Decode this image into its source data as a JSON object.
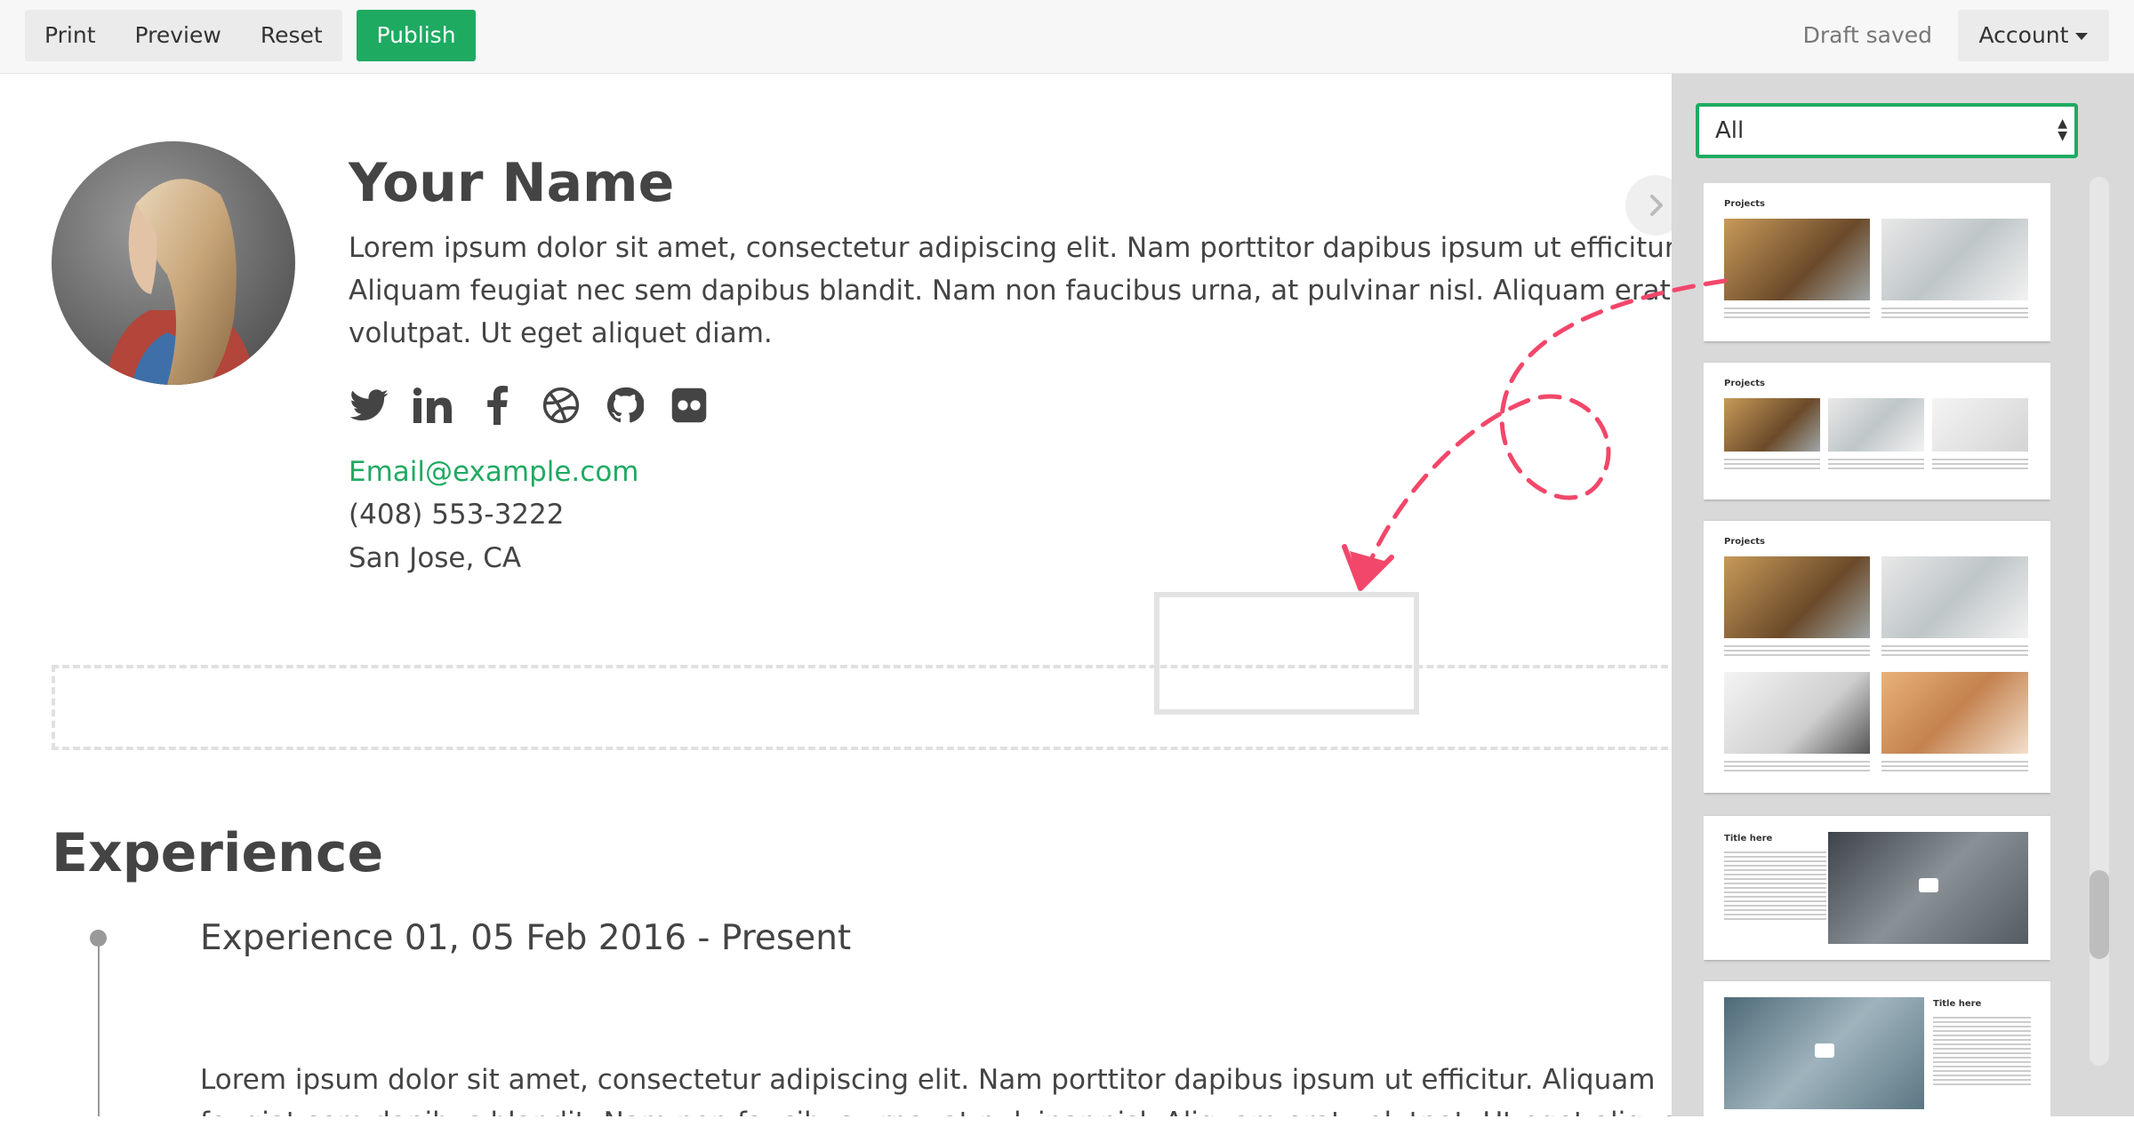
{
  "toolbar": {
    "print_label": "Print",
    "preview_label": "Preview",
    "reset_label": "Reset",
    "publish_label": "Publish",
    "status": "Draft saved",
    "account_label": "Account"
  },
  "profile": {
    "name": "Your Name",
    "bio": "Lorem ipsum dolor sit amet, consectetur adipiscing elit. Nam porttitor dapibus ipsum ut efficitur. Aliquam feugiat nec sem dapibus blandit. Nam non faucibus urna, at pulvinar nisl. Aliquam erat volutpat. Ut eget aliquet diam.",
    "social_icons": [
      "twitter-icon",
      "linkedin-icon",
      "facebook-icon",
      "dribbble-icon",
      "github-icon",
      "flickr-icon"
    ],
    "email": "Email@example.com",
    "phone": "(408) 553-3222",
    "location": "San Jose, CA"
  },
  "experience": {
    "heading": "Experience",
    "items": [
      {
        "title": "Experience 01, 05 Feb 2016 - Present",
        "text": "Lorem ipsum dolor sit amet, consectetur adipiscing elit. Nam porttitor dapibus ipsum ut efficitur. Aliquam feugiat sem dapibus blandit. Nam non faucibus urna, at pulvinar nisl. Aliquam erat volutpat. Ut eget aliquet diam. In et Lorem ipsum dolor sit amet, consectetur adipiscing elit. Nam porttitor dapibus ipsum ut efficitur."
      }
    ]
  },
  "sidebar": {
    "filter_value": "All",
    "thumbnails": [
      {
        "label": "Projects"
      },
      {
        "label": "Projects"
      },
      {
        "label": "Projects"
      },
      {
        "label": "Title here"
      },
      {
        "label": "Title here"
      }
    ]
  },
  "colors": {
    "accent": "#1faa62",
    "arrow": "#f2476a"
  }
}
